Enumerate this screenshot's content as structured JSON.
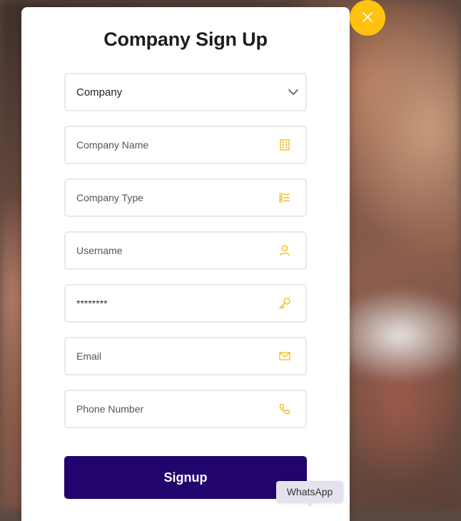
{
  "modal": {
    "title": "Company Sign Up",
    "close_icon": "close-icon"
  },
  "form": {
    "company_select": {
      "value": "Company",
      "icon": "chevron-down-icon"
    },
    "company_name": {
      "placeholder": "Company Name",
      "value": "",
      "icon": "building-icon"
    },
    "company_type": {
      "placeholder": "Company Type",
      "value": "",
      "icon": "list-icon"
    },
    "username": {
      "placeholder": "Username",
      "value": "",
      "icon": "user-icon"
    },
    "password": {
      "placeholder": "",
      "value": "********",
      "icon": "key-icon"
    },
    "email": {
      "placeholder": "Email",
      "value": "",
      "icon": "mail-icon"
    },
    "phone": {
      "placeholder": "Phone Number",
      "value": "",
      "icon": "phone-icon"
    },
    "submit_label": "Signup"
  },
  "whatsapp_tooltip": "WhatsApp",
  "colors": {
    "accent": "#ffc20e",
    "primary_button": "#22046e",
    "field_border": "#e9e9ec",
    "icon": "#f2b705"
  }
}
